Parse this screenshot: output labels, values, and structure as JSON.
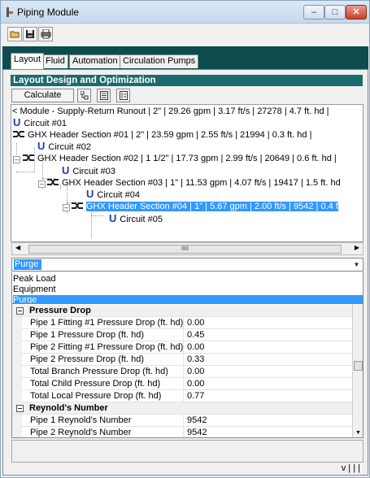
{
  "window": {
    "title": "Piping Module"
  },
  "toolbar": {
    "icons": [
      "open-folder-icon",
      "save-icon",
      "print-icon"
    ]
  },
  "tabs": [
    {
      "label": "Layout",
      "active": true
    },
    {
      "label": "Fluid",
      "active": false
    },
    {
      "label": "Automation",
      "active": false
    },
    {
      "label": "Circulation Pumps",
      "active": false
    }
  ],
  "section": {
    "title": "Layout Design and Optimization"
  },
  "calculate": {
    "label": "Calculate"
  },
  "tree": {
    "rows": [
      {
        "type": "header",
        "text": "< Module - Supply-Return Runout   | 2\" |  29.26 gpm  |  3.17 ft/s  |  27278  |  4.7 ft. hd |"
      },
      {
        "type": "circuit",
        "text": "Circuit #01"
      },
      {
        "type": "header",
        "text": "GHX Header Section #01   | 2\" |  23.59 gpm  |  2.55 ft/s  |  21994  |  0.3 ft. hd |"
      },
      {
        "type": "circuit",
        "text": "Circuit #02"
      },
      {
        "type": "header",
        "text": "GHX Header Section #02   | 1 1/2\" |  17.73 gpm  |  2.99 ft/s  |  20649  |  0.6 ft. hd |"
      },
      {
        "type": "circuit",
        "text": "Circuit #03"
      },
      {
        "type": "header",
        "text": "GHX Header Section #03   | 1\" |  11.53 gpm  |  4.07 ft/s  |  19417  |  1.5 ft. hd"
      },
      {
        "type": "circuit",
        "text": "Circuit #04"
      },
      {
        "type": "header",
        "text": "GHX Header Section #04   | 1\" |  5.67 gpm  |  2.00 ft/s  |  9542  |  0.4 f",
        "selected": true
      },
      {
        "type": "circuit",
        "text": "Circuit #05"
      }
    ]
  },
  "combo": {
    "value": "Purge"
  },
  "combo_list": [
    "Peak Load",
    "Equipment",
    "Purge"
  ],
  "properties": [
    {
      "kind": "category",
      "label": "Pressure Drop"
    },
    {
      "kind": "prop",
      "name": "Pipe 1 Fitting #1 Pressure Drop (ft. hd)",
      "value": "0.00"
    },
    {
      "kind": "prop",
      "name": "Pipe 1 Pressure Drop (ft. hd)",
      "value": "0.45"
    },
    {
      "kind": "prop",
      "name": "Pipe 2 Fitting #1 Pressure Drop (ft. hd)",
      "value": "0.00"
    },
    {
      "kind": "prop",
      "name": "Pipe 2 Pressure Drop (ft. hd)",
      "value": "0.33"
    },
    {
      "kind": "prop",
      "name": "Total Branch Pressure Drop (ft. hd)",
      "value": "0.00"
    },
    {
      "kind": "prop",
      "name": "Total Child Pressure Drop (ft. hd)",
      "value": "0.00"
    },
    {
      "kind": "prop",
      "name": "Total Local Pressure Drop (ft. hd)",
      "value": "0.77"
    },
    {
      "kind": "category",
      "label": "Reynold's Number"
    },
    {
      "kind": "prop",
      "name": "Pipe 1 Reynold's Number",
      "value": "9542"
    },
    {
      "kind": "prop",
      "name": "Pipe 2 Reynold's Number",
      "value": "9542"
    }
  ],
  "status": {
    "text": "v | | |"
  },
  "colors": {
    "accent_dark": "#0d4c4c",
    "header": "#1a6b6b",
    "selection": "#3399ff"
  }
}
